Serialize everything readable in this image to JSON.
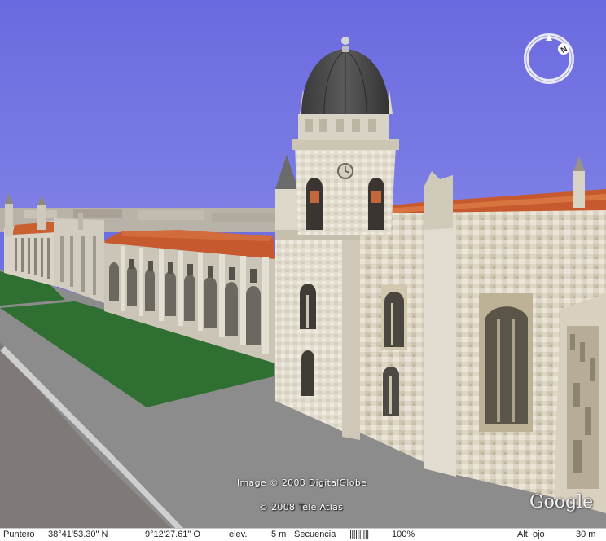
{
  "map": {
    "attribution_image": "Image © 2008 DigitalGlobe",
    "attribution_tele": "© 2008 Tele Atlas",
    "brand": "Google",
    "compass_label": "N",
    "colors": {
      "sky": "#6e6ee0",
      "road": "#8c8c8c",
      "lawn": "#2f6f32",
      "roof": "#c65a2e",
      "stone": "#e6e1d6",
      "dome": "#4a4a4a"
    }
  },
  "status": {
    "pointer_label": "Puntero",
    "lat": "38°41'53.30\" N",
    "lon": "9°12'27.61\" O",
    "elev_label": "elev.",
    "elev_value": "5 m",
    "stream_label": "Secuencia",
    "stream_bar": "||||||||||",
    "stream_pct": "100%",
    "eye_label": "Alt. ojo",
    "eye_value": "30 m"
  }
}
